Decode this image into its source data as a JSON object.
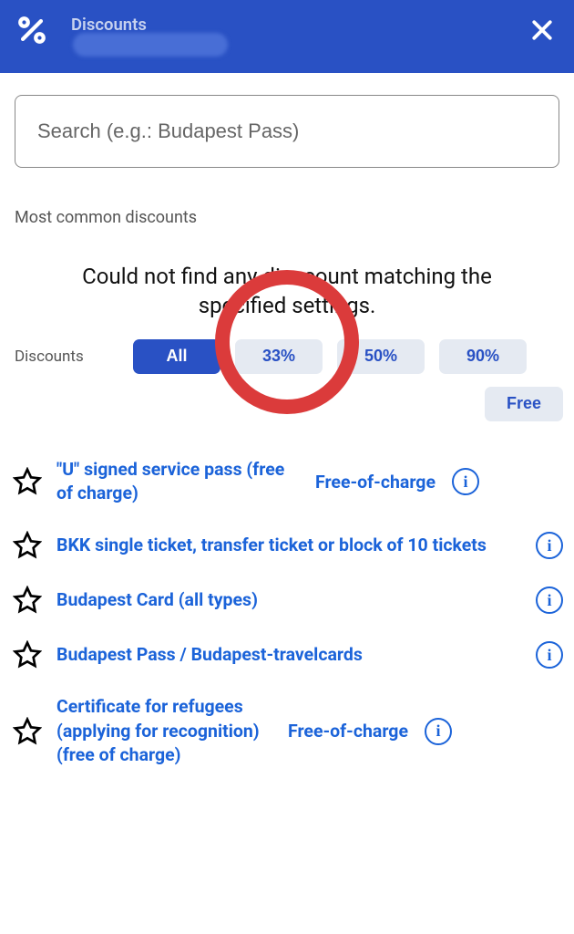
{
  "header": {
    "title": "Discounts"
  },
  "search": {
    "placeholder": "Search (e.g.: Budapest Pass)"
  },
  "sectionLabel": "Most common discounts",
  "noResults": "Could not find any disacount matching the specified settings.",
  "filters": {
    "label": "Discounts",
    "chips": {
      "all": "All",
      "p33": "33%",
      "p50": "50%",
      "p90": "90%",
      "free": "Free"
    }
  },
  "items": [
    {
      "label": "\"U\" signed service pass (free of charge)",
      "badge": "Free-of-charge"
    },
    {
      "label": "BKK single ticket, transfer ticket or block of 10 tickets",
      "badge": ""
    },
    {
      "label": "Budapest Card (all types)",
      "badge": ""
    },
    {
      "label": "Budapest Pass / Budapest-travelcards",
      "badge": ""
    },
    {
      "label": "Certificate for refugees (applying for recognition) (free of charge)",
      "badge": "Free-of-charge"
    }
  ]
}
